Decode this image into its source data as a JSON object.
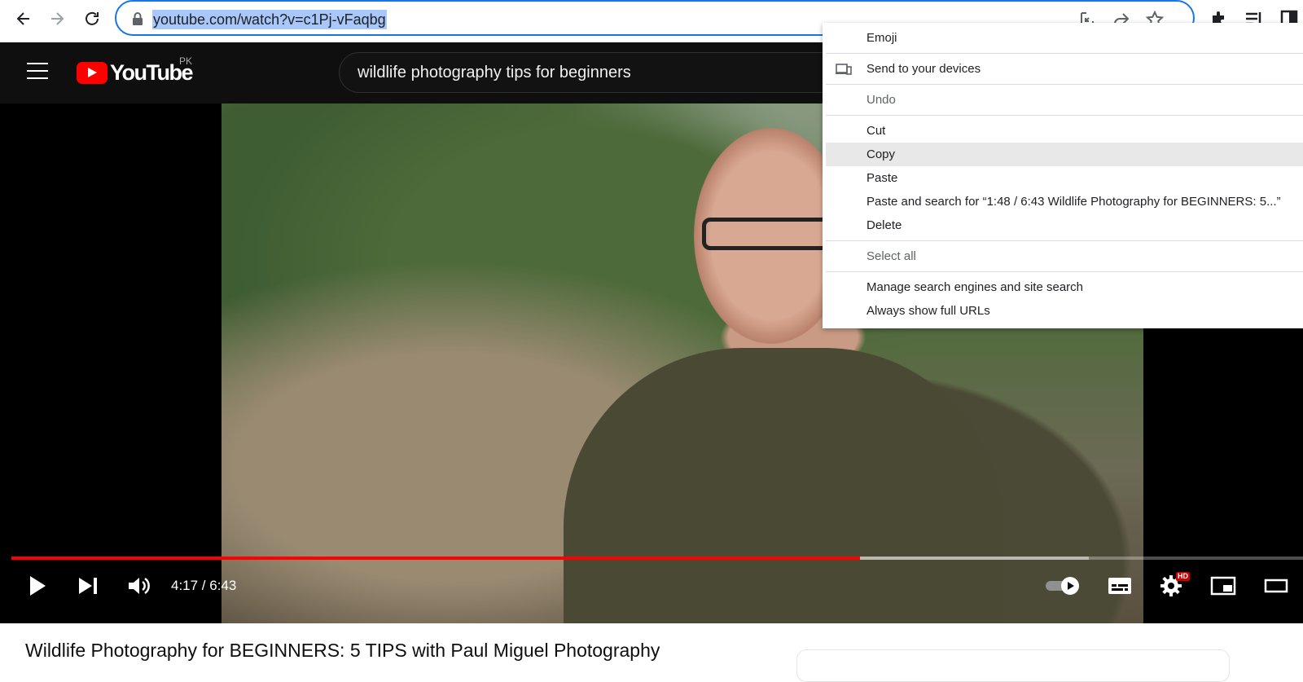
{
  "browser": {
    "url": "youtube.com/watch?v=c1Pj-vFaqbg"
  },
  "youtube": {
    "logo_text": "YouTube",
    "country": "PK",
    "search_query": "wildlife photography tips for beginners"
  },
  "player": {
    "current_time": "4:17",
    "duration": "6:43",
    "time_display": "4:17 / 6:43",
    "played_fraction": 0.657,
    "buffered_fraction": 0.834,
    "hd_badge": "HD",
    "accent_color": "#ff0000"
  },
  "video": {
    "title": "Wildlife Photography for BEGINNERS: 5 TIPS with Paul Miguel Photography"
  },
  "context_menu": {
    "items": [
      {
        "label": "Emoji",
        "disabled": false
      },
      {
        "label": "Send to your devices",
        "disabled": false,
        "icon": "devices-icon"
      },
      {
        "label": "Undo",
        "disabled": true
      },
      {
        "label": "Cut",
        "disabled": false
      },
      {
        "label": "Copy",
        "disabled": false,
        "highlighted": true
      },
      {
        "label": "Paste",
        "disabled": false
      },
      {
        "label": "Paste and search for “1:48 / 6:43 Wildlife Photography for BEGINNERS: 5...”",
        "disabled": false
      },
      {
        "label": "Delete",
        "disabled": false
      },
      {
        "label": "Select all",
        "disabled": true
      },
      {
        "label": "Manage search engines and site search",
        "disabled": false
      },
      {
        "label": "Always show full URLs",
        "disabled": false
      }
    ]
  }
}
